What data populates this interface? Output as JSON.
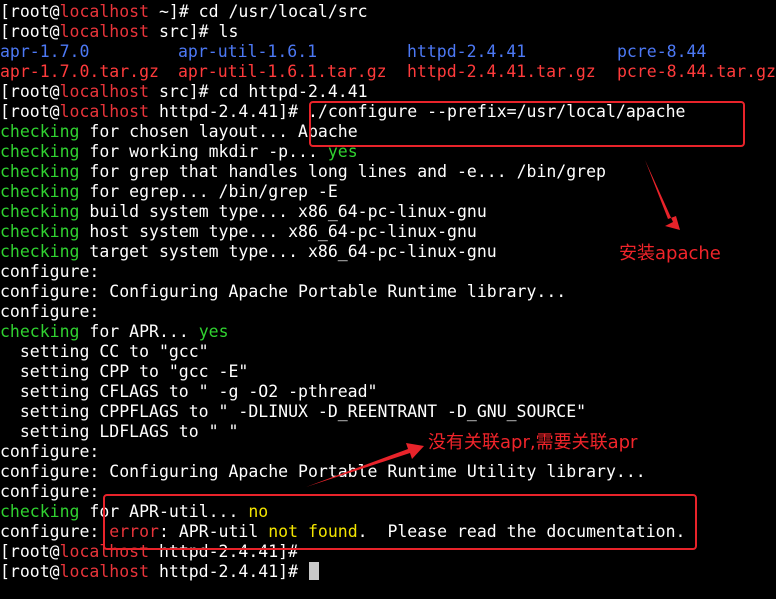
{
  "colors": {
    "background": "#000000",
    "default_text": "#ffffff",
    "host_red": "#e8343a",
    "green": "#30d230",
    "dir_blue": "#4c79f5",
    "archive_red": "#ff3b3b",
    "yellow": "#f2e400",
    "annotation_red": "#f0242a"
  },
  "lines": [
    [
      {
        "t": "[root@",
        "c": "default_text"
      },
      {
        "t": "localhost",
        "c": "host_red"
      },
      {
        "t": " ~]# cd /usr/local/src",
        "c": "default_text"
      }
    ],
    [
      {
        "t": "[root@",
        "c": "default_text"
      },
      {
        "t": "localhost",
        "c": "host_red"
      },
      {
        "t": " src]# ls",
        "c": "default_text"
      }
    ],
    null,
    null,
    [
      {
        "t": "[root@",
        "c": "default_text"
      },
      {
        "t": "localhost",
        "c": "host_red"
      },
      {
        "t": " src]# cd httpd-2.4.41",
        "c": "default_text"
      }
    ],
    [
      {
        "t": "[root@",
        "c": "default_text"
      },
      {
        "t": "localhost",
        "c": "host_red"
      },
      {
        "t": " httpd-2.4.41]# ./configure --prefix=/usr/local/apache",
        "c": "default_text"
      }
    ],
    [
      {
        "t": "checking",
        "c": "green"
      },
      {
        "t": " for chosen layout... Apache",
        "c": "default_text"
      }
    ],
    [
      {
        "t": "checking",
        "c": "green"
      },
      {
        "t": " for working mkdir -p... ",
        "c": "default_text"
      },
      {
        "t": "yes",
        "c": "green"
      }
    ],
    [
      {
        "t": "checking",
        "c": "green"
      },
      {
        "t": " for grep that handles long lines and -e... /bin/grep",
        "c": "default_text"
      }
    ],
    [
      {
        "t": "checking",
        "c": "green"
      },
      {
        "t": " for egrep... /bin/grep -E",
        "c": "default_text"
      }
    ],
    [
      {
        "t": "checking",
        "c": "green"
      },
      {
        "t": " build system type... x86_64-pc-linux-gnu",
        "c": "default_text"
      }
    ],
    [
      {
        "t": "checking",
        "c": "green"
      },
      {
        "t": " host system type... x86_64-pc-linux-gnu",
        "c": "default_text"
      }
    ],
    [
      {
        "t": "checking",
        "c": "green"
      },
      {
        "t": " target system type... x86_64-pc-linux-gnu",
        "c": "default_text"
      }
    ],
    [
      {
        "t": "configure:",
        "c": "default_text"
      }
    ],
    [
      {
        "t": "configure: Configuring Apache Portable Runtime library...",
        "c": "default_text"
      }
    ],
    [
      {
        "t": "configure:",
        "c": "default_text"
      }
    ],
    [
      {
        "t": "checking",
        "c": "green"
      },
      {
        "t": " for APR... ",
        "c": "default_text"
      },
      {
        "t": "yes",
        "c": "green"
      }
    ],
    [
      {
        "t": "  setting CC to \"gcc\"",
        "c": "default_text"
      }
    ],
    [
      {
        "t": "  setting CPP to \"gcc -E\"",
        "c": "default_text"
      }
    ],
    [
      {
        "t": "  setting CFLAGS to \" -g -O2 -pthread\"",
        "c": "default_text"
      }
    ],
    [
      {
        "t": "  setting CPPFLAGS to \" -DLINUX -D_REENTRANT -D_GNU_SOURCE\"",
        "c": "default_text"
      }
    ],
    [
      {
        "t": "  setting LDFLAGS to \" \"",
        "c": "default_text"
      }
    ],
    [
      {
        "t": "configure:",
        "c": "default_text"
      }
    ],
    [
      {
        "t": "configure: Configuring Apache Portable Runtime Utility library...",
        "c": "default_text"
      }
    ],
    [
      {
        "t": "configure:",
        "c": "default_text"
      }
    ],
    [
      {
        "t": "checking",
        "c": "green"
      },
      {
        "t": " for APR-util... ",
        "c": "default_text"
      },
      {
        "t": "no",
        "c": "yellow"
      }
    ],
    [
      {
        "t": "configure: ",
        "c": "default_text"
      },
      {
        "t": "error",
        "c": "host_red"
      },
      {
        "t": ": APR-util ",
        "c": "default_text"
      },
      {
        "t": "not found",
        "c": "yellow"
      },
      {
        "t": ".  Please read the documentation.",
        "c": "default_text"
      }
    ],
    [
      {
        "t": "[root@",
        "c": "default_text"
      },
      {
        "t": "localhost",
        "c": "host_red"
      },
      {
        "t": " httpd-2.4.41]#",
        "c": "default_text"
      }
    ],
    [
      {
        "t": "[root@",
        "c": "default_text"
      },
      {
        "t": "localhost",
        "c": "host_red"
      },
      {
        "t": " httpd-2.4.41]# ",
        "c": "default_text"
      }
    ]
  ],
  "ls_output": [
    {
      "t": "apr-1.7.0",
      "c": "dir_blue",
      "row": 2,
      "col": 0
    },
    {
      "t": "apr-util-1.6.1",
      "c": "dir_blue",
      "row": 2,
      "col": 1
    },
    {
      "t": "httpd-2.4.41",
      "c": "dir_blue",
      "row": 2,
      "col": 2
    },
    {
      "t": "pcre-8.44",
      "c": "dir_blue",
      "row": 2,
      "col": 3
    },
    {
      "t": "apr-1.7.0.tar.gz",
      "c": "archive_red",
      "row": 3,
      "col": 0
    },
    {
      "t": "apr-util-1.6.1.tar.gz",
      "c": "archive_red",
      "row": 3,
      "col": 1
    },
    {
      "t": "httpd-2.4.41.tar.gz",
      "c": "archive_red",
      "row": 3,
      "col": 2
    },
    {
      "t": "pcre-8.44.tar.gz",
      "c": "archive_red",
      "row": 3,
      "col": 3
    }
  ],
  "annotations": {
    "install": "安装apache",
    "apr_note": "没有关联apr,需要关联apr"
  }
}
